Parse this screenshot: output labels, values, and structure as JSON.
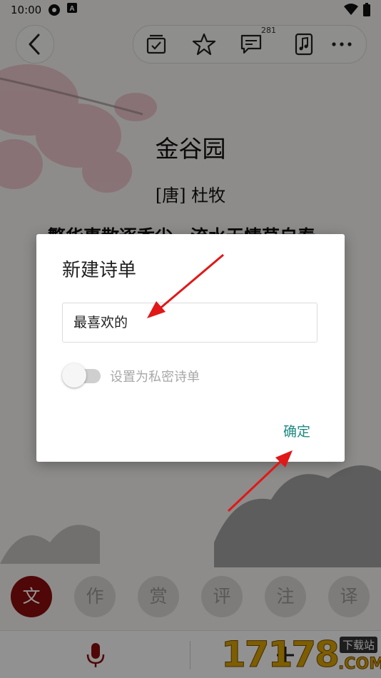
{
  "status_bar": {
    "time": "10:00"
  },
  "header": {
    "comment_count": "281"
  },
  "poem": {
    "title": "金谷园",
    "author": "[唐] 杜牧",
    "first_line": "繁华事散逐香尘，流水无情草自春。"
  },
  "tabs": [
    {
      "label": "文",
      "active": true
    },
    {
      "label": "作",
      "active": false
    },
    {
      "label": "赏",
      "active": false
    },
    {
      "label": "评",
      "active": false
    },
    {
      "label": "注",
      "active": false
    },
    {
      "label": "译",
      "active": false
    }
  ],
  "dialog": {
    "title": "新建诗单",
    "input_value": "最喜欢的",
    "private_toggle_label": "设置为私密诗单",
    "private_toggle_on": false,
    "confirm_label": "确定"
  },
  "watermark": {
    "number": "17178",
    "tag": "下载站",
    "domain": ".COM"
  },
  "colors": {
    "accent": "#1f8a80",
    "active_tab": "#8b0d0d",
    "arrow": "#e01818"
  },
  "icons": [
    "back-icon",
    "checklist-icon",
    "star-icon",
    "comment-icon",
    "music-icon",
    "more-icon",
    "microphone-icon",
    "plus-icon"
  ]
}
